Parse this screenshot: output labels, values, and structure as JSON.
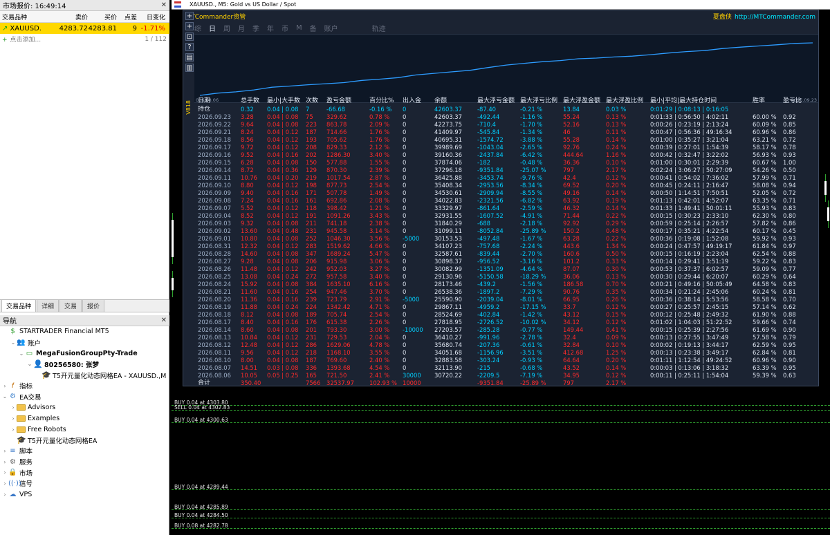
{
  "market_watch": {
    "title": "市场报价: 16:49:14",
    "columns": [
      "交易品种",
      "卖价",
      "买价",
      "点差",
      "日变化"
    ],
    "row": {
      "symbol": "XAUUSD.",
      "bid": "4283.72",
      "ask": "4283.81",
      "spread": "9",
      "change": "-1.71%"
    },
    "add_label": "点击添加...",
    "count": "1 / 112"
  },
  "bottom_tabs": [
    "交易品种",
    "详细",
    "交易",
    "报价"
  ],
  "navigator": {
    "title": "导航",
    "items": [
      {
        "label": "STARTRADER Financial MT5",
        "indent": 0,
        "icon": "broker-icon"
      },
      {
        "label": "账户",
        "indent": 1,
        "icon": "accounts-icon",
        "exp": "v"
      },
      {
        "label": "MegaFusionGroupPty-Trade",
        "indent": 2,
        "icon": "server-icon",
        "exp": "v",
        "bold": true
      },
      {
        "label": "80256580: 张梦",
        "indent": 3,
        "icon": "user-icon",
        "exp": "v",
        "bold": true
      },
      {
        "label": "T5开元量化动态网格EA - XAUUSD.,M",
        "indent": 4,
        "icon": "ea-icon"
      },
      {
        "label": "指标",
        "indent": 0,
        "icon": "indicators-icon",
        "exp": ">"
      },
      {
        "label": "EA交易",
        "indent": 0,
        "icon": "experts-icon",
        "exp": "v"
      },
      {
        "label": "Advisors",
        "indent": 1,
        "icon": "folder-icon",
        "exp": ">"
      },
      {
        "label": "Examples",
        "indent": 1,
        "icon": "folder-icon",
        "exp": ">"
      },
      {
        "label": "Free Robots",
        "indent": 1,
        "icon": "folder-icon",
        "exp": ">"
      },
      {
        "label": "T5开元量化动态网格EA",
        "indent": 1,
        "icon": "ea-icon"
      },
      {
        "label": "脚本",
        "indent": 0,
        "icon": "scripts-icon",
        "exp": ">"
      },
      {
        "label": "服务",
        "indent": 0,
        "icon": "services-icon",
        "exp": ">"
      },
      {
        "label": "市场",
        "indent": 0,
        "icon": "market-icon",
        "exp": ">"
      },
      {
        "label": "信号",
        "indent": 0,
        "icon": "signals-icon",
        "exp": ">"
      },
      {
        "label": "VPS",
        "indent": 0,
        "icon": "vps-icon",
        "exp": ">"
      }
    ]
  },
  "chart": {
    "title": "XAUUSD., M5:  Gold vs US Dollar / Spot",
    "ea_name": "MTCommander资管",
    "ea_link_cn": "夏盘侠",
    "ea_link": "http://MTCommander.com",
    "ea_tabs": [
      "综",
      "日",
      "周",
      "月",
      "季",
      "年",
      "币",
      "M",
      "备",
      "账户",
      "轨迹"
    ],
    "ea_active_tab": "日",
    "curve_start": "026.08.06",
    "curve_end": "2026.09.23",
    "side_label": "V818",
    "toolbar": [
      "+",
      "+",
      "⊡",
      "?",
      "▤",
      "▥"
    ]
  },
  "stats": {
    "columns": [
      "日期",
      "总手数",
      "最小|大手数",
      "次数",
      "盈亏金额",
      "百分比%",
      "出入金",
      "余额",
      "最大浮亏金额",
      "最大浮亏比例",
      "最大浮盈金额",
      "最大浮盈比例",
      "最小|平均|最大持仓时间",
      "胜率",
      "盈亏比"
    ],
    "hold": [
      "持仓",
      "0.32",
      "0.04 | 0.08",
      "7",
      "-66.68",
      "-0.16 %",
      "0",
      "42603.37",
      "-87.40",
      "-0.21 %",
      "13.84",
      "0.03 %",
      "0:01:29 | 0:08:13 | 0:16:05",
      "",
      ""
    ],
    "rows": [
      [
        "2026.09.23",
        "3.28",
        "0.04 | 0.08",
        "75",
        "329.62",
        "0.78 %",
        "0",
        "42603.37",
        "-492.44",
        "-1.16 %",
        "55.24",
        "0.13 %",
        "0:01:33 | 0:56:50 | 4:02:11",
        "60.00 %",
        "0.92"
      ],
      [
        "2026.09.22",
        "9.64",
        "0.04 | 0.08",
        "223",
        "863.78",
        "2.09 %",
        "0",
        "42273.75",
        "-710.4",
        "-1.70 %",
        "52.16",
        "0.13 %",
        "0:00:26 | 0:23:19 | 2:13:24",
        "60.09 %",
        "0.85"
      ],
      [
        "2026.09.21",
        "8.24",
        "0.04 | 0.12",
        "187",
        "714.66",
        "1.76 %",
        "0",
        "41409.97",
        "-545.84",
        "-1.34 %",
        "46",
        "0.11 %",
        "0:00:47 | 0:56:36 | 49:16:34",
        "60.96 %",
        "0.86"
      ],
      [
        "2026.09.18",
        "8.56",
        "0.04 | 0.12",
        "193",
        "705.62",
        "1.76 %",
        "0",
        "40695.31",
        "-1574.72",
        "-3.88 %",
        "55.28",
        "0.14 %",
        "0:01:00 | 0:35:27 | 3:21:04",
        "63.21 %",
        "0.72"
      ],
      [
        "2026.09.17",
        "9.72",
        "0.04 | 0.12",
        "208",
        "829.33",
        "2.12 %",
        "0",
        "39989.69",
        "-1043.04",
        "-2.65 %",
        "92.76",
        "0.24 %",
        "0:00:39 | 0:27:01 | 1:54:39",
        "58.17 %",
        "0.78"
      ],
      [
        "2026.09.16",
        "9.52",
        "0.04 | 0.16",
        "202",
        "1286.30",
        "3.40 %",
        "0",
        "39160.36",
        "-2437.84",
        "-6.42 %",
        "444.64",
        "1.16 %",
        "0:00:42 | 0:32:47 | 3:22:02",
        "56.93 %",
        "0.93"
      ],
      [
        "2026.09.15",
        "6.28",
        "0.04 | 0.08",
        "150",
        "577.88",
        "1.55 %",
        "0",
        "37874.06",
        "-182",
        "-0.48 %",
        "36.36",
        "0.10 %",
        "0:01:00 | 0:30:01 | 2:29:39",
        "60.67 %",
        "1.00"
      ],
      [
        "2026.09.14",
        "8.72",
        "0.04 | 0.36",
        "129",
        "870.30",
        "2.39 %",
        "0",
        "37296.18",
        "-9351.84",
        "-25.07 %",
        "797",
        "2.17 %",
        "0:02:24 | 3:06:27 | 50:27:09",
        "54.26 %",
        "0.50"
      ],
      [
        "2026.09.11",
        "10.76",
        "0.04 | 0.20",
        "219",
        "1017.54",
        "2.87 %",
        "0",
        "36425.88",
        "-3453.74",
        "-9.76 %",
        "42.4",
        "0.12 %",
        "0:00:41 | 0:54:02 | 7:36:02",
        "57.99 %",
        "0.71"
      ],
      [
        "2026.09.10",
        "8.80",
        "0.04 | 0.12",
        "198",
        "877.73",
        "2.54 %",
        "0",
        "35408.34",
        "-2953.56",
        "-8.34 %",
        "69.52",
        "0.20 %",
        "0:00:45 | 0:24:11 | 2:16:47",
        "58.08 %",
        "0.94"
      ],
      [
        "2026.09.09",
        "9.40",
        "0.04 | 0.16",
        "171",
        "507.78",
        "1.49 %",
        "0",
        "34530.61",
        "-2909.94",
        "-8.55 %",
        "49.16",
        "0.14 %",
        "0:00:50 | 1:14:51 | 7:50:51",
        "52.05 %",
        "0.72"
      ],
      [
        "2026.09.08",
        "7.24",
        "0.04 | 0.16",
        "161",
        "692.86",
        "2.08 %",
        "0",
        "34022.83",
        "-2321.56",
        "-6.82 %",
        "63.92",
        "0.19 %",
        "0:01:13 | 0:42:01 | 4:52:07",
        "63.35 %",
        "0.71"
      ],
      [
        "2026.09.07",
        "5.52",
        "0.04 | 0.12",
        "118",
        "398.42",
        "1.21 %",
        "0",
        "33329.97",
        "-861.64",
        "-2.59 %",
        "46.32",
        "0.14 %",
        "0:01:33 | 1:49:41 | 50:01:11",
        "55.93 %",
        "0.83"
      ],
      [
        "2026.09.04",
        "8.52",
        "0.04 | 0.12",
        "191",
        "1091.26",
        "3.43 %",
        "0",
        "32931.55",
        "-1607.52",
        "-4.91 %",
        "71.44",
        "0.22 %",
        "0:00:15 | 0:30:23 | 2:33:10",
        "62.30 %",
        "0.80"
      ],
      [
        "2026.09.03",
        "9.32",
        "0.04 | 0.08",
        "211",
        "741.18",
        "2.38 %",
        "0",
        "31840.29",
        "-688",
        "-2.18 %",
        "92.92",
        "0.29 %",
        "0:00:59 | 0:25:14 | 2:26:57",
        "57.82 %",
        "0.86"
      ],
      [
        "2026.09.02",
        "13.60",
        "0.04 | 0.48",
        "231",
        "945.58",
        "3.14 %",
        "0",
        "31099.11",
        "-8052.84",
        "-25.89 %",
        "150.2",
        "0.48 %",
        "0:00:17 | 0:35:21 | 4:22:54",
        "60.17 %",
        "0.45"
      ],
      [
        "2026.09.01",
        "10.80",
        "0.04 | 0.08",
        "252",
        "1046.30",
        "3.56 %",
        "-5000",
        "30153.53",
        "-497.48",
        "-1.67 %",
        "63.28",
        "0.22 %",
        "0:00:36 | 0:19:08 | 1:52:08",
        "59.92 %",
        "0.93"
      ],
      [
        "2026.08.31",
        "12.32",
        "0.04 | 0.12",
        "283",
        "1519.62",
        "4.66 %",
        "0",
        "34107.23",
        "-757.68",
        "-2.24 %",
        "443.6",
        "1.34 %",
        "0:00:24 | 0:47:57 | 49:19:17",
        "61.84 %",
        "0.97"
      ],
      [
        "2026.08.28",
        "14.60",
        "0.04 | 0.08",
        "347",
        "1689.24",
        "5.47 %",
        "0",
        "32587.61",
        "-839.44",
        "-2.70 %",
        "160.6",
        "0.50 %",
        "0:00:15 | 0:16:19 | 2:23:04",
        "62.54 %",
        "0.88"
      ],
      [
        "2026.08.27",
        "9.28",
        "0.04 | 0.08",
        "206",
        "915.98",
        "3.06 %",
        "0",
        "30898.37",
        "-956.52",
        "-3.16 %",
        "101.2",
        "0.33 %",
        "0:00:14 | 0:29:41 | 3:51:19",
        "59.22 %",
        "0.83"
      ],
      [
        "2026.08.26",
        "11.48",
        "0.04 | 0.12",
        "242",
        "952.03",
        "3.27 %",
        "0",
        "30082.99",
        "-1351.09",
        "-4.64 %",
        "87.07",
        "0.30 %",
        "0:00:53 | 0:37:37 | 6:02:57",
        "59.09 %",
        "0.77"
      ],
      [
        "2026.08.25",
        "13.08",
        "0.04 | 0.24",
        "272",
        "957.58",
        "3.40 %",
        "0",
        "29130.96",
        "-5150.58",
        "-18.29 %",
        "36.06",
        "0.13 %",
        "0:00:30 | 0:29:44 | 6:20:07",
        "60.29 %",
        "0.64"
      ],
      [
        "2026.08.24",
        "15.92",
        "0.04 | 0.08",
        "384",
        "1635.10",
        "6.16 %",
        "0",
        "28173.46",
        "-439.2",
        "-1.56 %",
        "186.58",
        "0.70 %",
        "0:00:21 | 0:49:16 | 50:05:49",
        "64.58 %",
        "0.83"
      ],
      [
        "2026.08.21",
        "11.60",
        "0.04 | 0.16",
        "254",
        "947.46",
        "3.70 %",
        "0",
        "26538.36",
        "-1897.2",
        "-7.29 %",
        "90.76",
        "0.35 %",
        "0:00:34 | 0:21:24 | 2:45:06",
        "60.24 %",
        "0.81"
      ],
      [
        "2026.08.20",
        "11.36",
        "0.04 | 0.16",
        "239",
        "723.79",
        "2.91 %",
        "-5000",
        "25590.90",
        "-2039.04",
        "-8.01 %",
        "66.95",
        "0.26 %",
        "0:00:36 | 0:38:14 | 5:53:56",
        "58.58 %",
        "0.70"
      ],
      [
        "2026.08.19",
        "11.88",
        "0.04 | 0.24",
        "224",
        "1342.42",
        "4.71 %",
        "0",
        "29867.11",
        "-4959.2",
        "-17.15 %",
        "33.7",
        "0.12 %",
        "0:00:27 | 0:25:57 | 2:45:15",
        "57.14 %",
        "0.62"
      ],
      [
        "2026.08.18",
        "8.12",
        "0.04 | 0.08",
        "189",
        "705.74",
        "2.54 %",
        "0",
        "28524.69",
        "-402.84",
        "-1.42 %",
        "43.12",
        "0.15 %",
        "0:00:12 | 0:25:48 | 2:49:32",
        "61.90 %",
        "0.88"
      ],
      [
        "2026.08.17",
        "8.40",
        "0.04 | 0.16",
        "176",
        "615.38",
        "2.26 %",
        "0",
        "27818.95",
        "-2726.52",
        "-10.02 %",
        "34.12",
        "0.12 %",
        "0:01:02 | 1:04:03 | 51:22:52",
        "59.66 %",
        "0.74"
      ],
      [
        "2026.08.14",
        "8.60",
        "0.04 | 0.08",
        "201",
        "793.30",
        "3.00 %",
        "-10000",
        "27203.57",
        "-285.28",
        "-0.77 %",
        "149.44",
        "0.41 %",
        "0:00:15 | 0:25:39 | 2:27:56",
        "61.69 %",
        "0.90"
      ],
      [
        "2026.08.13",
        "10.84",
        "0.04 | 0.12",
        "231",
        "729.53",
        "2.04 %",
        "0",
        "36410.27",
        "-991.96",
        "-2.78 %",
        "32.4",
        "0.09 %",
        "0:00:13 | 0:27:55 | 3:47:49",
        "57.58 %",
        "0.79"
      ],
      [
        "2026.08.12",
        "12.48",
        "0.04 | 0.12",
        "286",
        "1629.06",
        "4.78 %",
        "0",
        "35680.74",
        "-207.36",
        "-0.61 %",
        "32.84",
        "0.10 %",
        "0:00:02 | 0:19:13 | 3:44:17",
        "62.59 %",
        "0.95"
      ],
      [
        "2026.08.11",
        "9.56",
        "0.04 | 0.12",
        "218",
        "1168.10",
        "3.55 %",
        "0",
        "34051.68",
        "-1156.96",
        "-3.51 %",
        "412.68",
        "1.25 %",
        "0:00:13 | 0:23:38 | 3:49:17",
        "62.84 %",
        "0.81"
      ],
      [
        "2026.08.10",
        "8.00",
        "0.04 | 0.08",
        "187",
        "769.60",
        "2.40 %",
        "0",
        "32883.58",
        "-303.24",
        "-0.93 %",
        "64.64",
        "0.20 %",
        "0:01:11 | 1:12:54 | 49:24:52",
        "60.96 %",
        "0.90"
      ],
      [
        "2026.08.07",
        "14.51",
        "0.03 | 0.08",
        "336",
        "1393.68",
        "4.54 %",
        "0",
        "32113.90",
        "-215",
        "-0.68 %",
        "43.52",
        "0.14 %",
        "0:00:03 | 0:13:06 | 3:18:32",
        "63.39 %",
        "0.95"
      ],
      [
        "2026.08.06",
        "10.05",
        "0.05 | 0.25",
        "165",
        "721.50",
        "2.41 %",
        "30000",
        "30720.22",
        "-2209.5",
        "-7.19 %",
        "34.95",
        "0.12 %",
        "0:00:11 | 0:25:11 | 1:54:04",
        "59.39 %",
        "0.63"
      ]
    ],
    "total": [
      "合计",
      "350.40",
      "",
      "7566",
      "32537.97",
      "102.93 %",
      "10000",
      "",
      "-9351.84",
      "-25.89 %",
      "797",
      "2.17 %",
      "",
      "",
      ""
    ]
  },
  "orders": [
    {
      "label": "BUY 0.04 at 4303.80"
    },
    {
      "label": "SELL 0.04 at 4302.83"
    },
    {
      "label": "BUY 0.04 at 4300.63"
    },
    {
      "label": "BUY 0.04 at 4289.44"
    },
    {
      "label": "BUY 0.04 at 4285.89"
    },
    {
      "label": "BUY 0.04 at 4284.50"
    },
    {
      "label": "BUY 0.08 at 4282.78"
    }
  ],
  "colors": {
    "accent": "#ffd800",
    "down": "#ff2b2b",
    "cyan": "#00cfff",
    "green": "#2fa02f",
    "panel": "#1b2332"
  }
}
